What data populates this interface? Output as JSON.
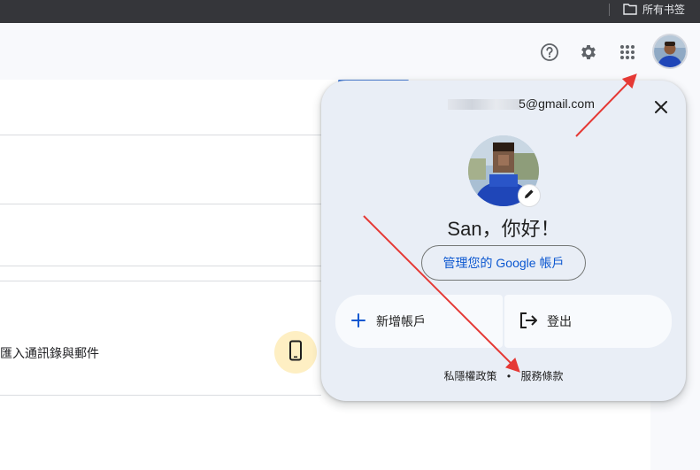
{
  "bookmarks_bar": {
    "folder_label": "所有书签",
    "folder_icon": "folder-icon"
  },
  "header": {
    "icons": [
      "help-icon",
      "gear-icon",
      "apps-grid-icon",
      "avatar"
    ]
  },
  "background": {
    "row_text": "匯入通訊錄與郵件",
    "phone_icon": "phone-icon",
    "phone_accent": "#feefc3"
  },
  "account_popup": {
    "email": "5@gmail.com",
    "greeting": "San，你好！",
    "manage_label": "管理您的 Google 帳戶",
    "add_account_label": "新增帳戶",
    "sign_out_label": "登出",
    "privacy_label": "私隱權政策",
    "separator": "•",
    "terms_label": "服務條款",
    "colors": {
      "panel": "#e9eef6",
      "link_blue": "#0b57d0",
      "annotation_red": "#e53935"
    }
  }
}
